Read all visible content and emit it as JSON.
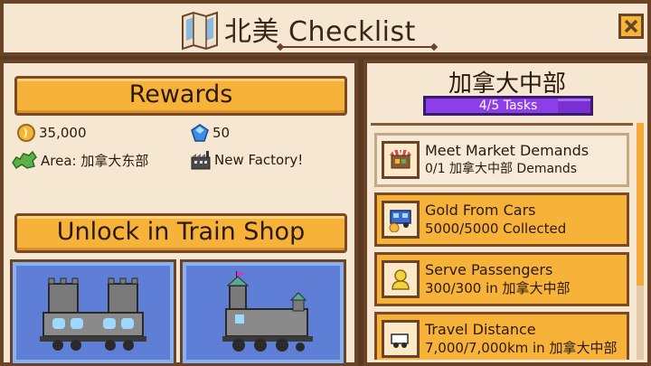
{
  "header": {
    "title": "北美 Checklist",
    "icons": {
      "map": "map-icon",
      "close": "close-icon"
    }
  },
  "rewards": {
    "heading": "Rewards",
    "items": [
      {
        "icon": "coin-icon",
        "label": "35,000"
      },
      {
        "icon": "gem-icon",
        "label": "50"
      },
      {
        "icon": "region-map-icon",
        "label": "Area: 加拿大东部"
      },
      {
        "icon": "factory-icon",
        "label": "New Factory!"
      }
    ]
  },
  "unlock": {
    "heading": "Unlock in Train Shop",
    "items": [
      {
        "icon": "castle-train-car-icon"
      },
      {
        "icon": "castle-locomotive-icon"
      }
    ]
  },
  "region": {
    "title": "加拿大中部",
    "progress_label": "4/5 Tasks",
    "progress_value": 0.8
  },
  "tasks": [
    {
      "icon": "market-stall-icon",
      "title": "Meet Market Demands",
      "detail": "0/1 加拿大中部 Demands",
      "status": "pending"
    },
    {
      "icon": "gold-car-icon",
      "title": "Gold From Cars",
      "detail": "5000/5000 Collected",
      "status": "done"
    },
    {
      "icon": "passenger-icon",
      "title": "Serve Passengers",
      "detail": "300/300 in 加拿大中部",
      "status": "done"
    },
    {
      "icon": "distance-icon",
      "title": "Travel Distance",
      "detail": "7,000/7,000km in 加拿大中部",
      "status": "done"
    }
  ],
  "colors": {
    "panel": "#f6e7d2",
    "border": "#6b4428",
    "button": "#f7b23a",
    "progress": "#7a2fd0",
    "shop_card": "#5f7fd6"
  }
}
